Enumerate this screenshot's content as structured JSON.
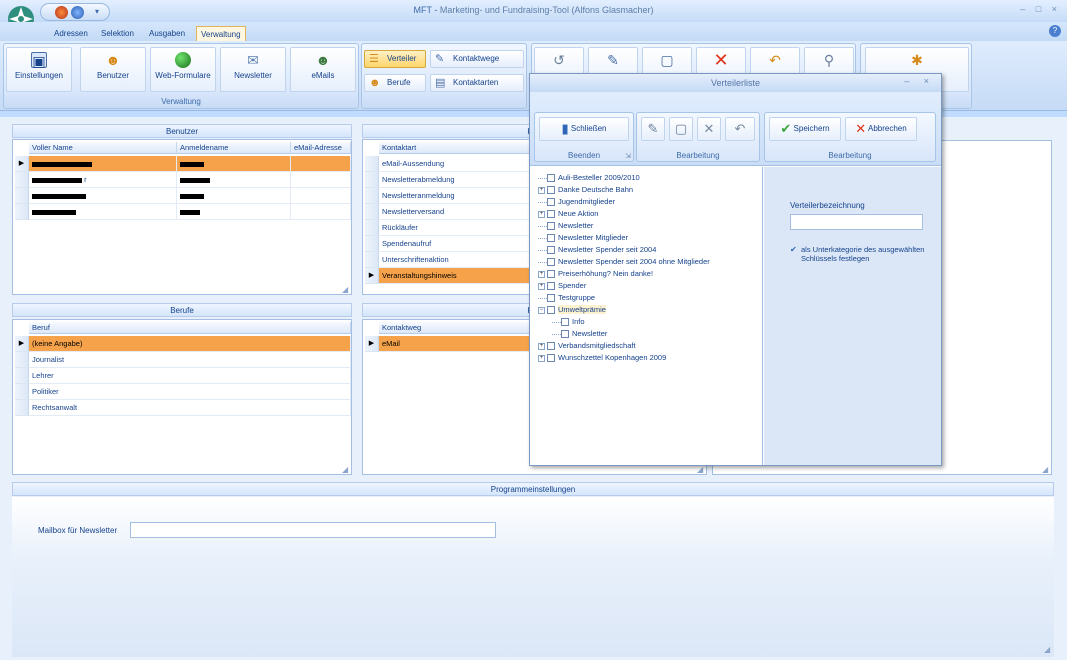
{
  "window": {
    "title_app": "MFT -",
    "title_main": "Marketing- und Fundraising-Tool (Alfons Glasmacher)",
    "controls": "– □ ×"
  },
  "menu": {
    "tabs": [
      "Adressen",
      "Selektion",
      "Ausgaben",
      "Verwaltung"
    ],
    "active": "Verwaltung"
  },
  "ribbon": {
    "verwaltung_group_label": "Verwaltung",
    "buttons_large": [
      "Einstellungen",
      "Benutzer",
      "Web-Formulare",
      "Newsletter",
      "eMails"
    ],
    "buttons_small": [
      "Verteiler",
      "Kontaktwege",
      "Berufe",
      "Kontaktarten"
    ]
  },
  "benutzer": {
    "title": "Benutzer",
    "columns": [
      "Voller Name",
      "Anmeldename",
      "eMail-Adresse"
    ],
    "rows": [
      {
        "name": "[redacted] er",
        "login": "[redacted]",
        "email": ""
      },
      {
        "name": "[redacted] r",
        "login": "[redacted]",
        "email": ""
      },
      {
        "name": "[redacted]",
        "login": "[redacted]",
        "email": ""
      },
      {
        "name": "[redacted]",
        "login": "[redacted]",
        "email": ""
      }
    ]
  },
  "kontaktarten": {
    "title": "Kon",
    "column": "Kontaktart",
    "rows": [
      "eMail-Aussendung",
      "Newsletterabmeldung",
      "Newsletteranmeldung",
      "Newsletterversand",
      "Rückläufer",
      "Spendenaufruf",
      "Unterschriftenaktion",
      "Veranstaltungshinweis"
    ],
    "selected": "Veranstaltungshinweis"
  },
  "berufe": {
    "title": "Berufe",
    "column": "Beruf",
    "rows": [
      "(keine Angabe)",
      "Journalist",
      "Lehrer",
      "Politiker",
      "Rechtsanwalt"
    ],
    "selected": "(keine Angabe)"
  },
  "kontaktwege": {
    "title": "Kon",
    "column": "Kontaktweg",
    "rows": [
      "eMail"
    ],
    "selected": "eMail"
  },
  "programmeinstellungen": {
    "title": "Programmeinstellungen",
    "mailbox_label": "Mailbox für Newsletter",
    "mailbox_value": ""
  },
  "dialog": {
    "title": "Verteilerliste",
    "controls": "– ×",
    "groups": {
      "beenden": "Beenden",
      "bearbeitung1": "Bearbeitung",
      "bearbeitung2": "Bearbeitung"
    },
    "buttons": {
      "schliessen": "Schließen",
      "speichern": "Speichern",
      "abbrechen": "Abbrechen"
    },
    "tree": [
      {
        "label": "Auli-Besteller 2009/2010",
        "expandable": false,
        "level": 0
      },
      {
        "label": "Danke Deutsche Bahn",
        "expandable": true,
        "level": 0
      },
      {
        "label": "Jugendmitglieder",
        "expandable": false,
        "level": 0
      },
      {
        "label": "Neue Aktion",
        "expandable": true,
        "level": 0
      },
      {
        "label": "Newsletter",
        "expandable": false,
        "level": 0
      },
      {
        "label": "Newsletter Mitglieder",
        "expandable": false,
        "level": 0
      },
      {
        "label": "Newsletter Spender seit 2004",
        "expandable": false,
        "level": 0
      },
      {
        "label": "Newsletter Spender seit 2004 ohne Mitglieder",
        "expandable": false,
        "level": 0
      },
      {
        "label": "Preiserhöhung? Nein danke!",
        "expandable": true,
        "level": 0
      },
      {
        "label": "Spender",
        "expandable": true,
        "level": 0
      },
      {
        "label": "Testgruppe",
        "expandable": false,
        "level": 0
      },
      {
        "label": "Umweltprämie",
        "expandable": true,
        "expanded": true,
        "level": 0,
        "highlight": true
      },
      {
        "label": "Info",
        "expandable": false,
        "level": 1
      },
      {
        "label": "Newsletter",
        "expandable": false,
        "level": 1
      },
      {
        "label": "Verbandsmitgliedschaft",
        "expandable": true,
        "level": 0
      },
      {
        "label": "Wunschzettel Kopenhagen 2009",
        "expandable": true,
        "level": 0
      }
    ],
    "verteiler_label": "Verteilerbezeichnung",
    "verteiler_value": "",
    "unterkategorie_checked": true,
    "unterkategorie_label": "als Unterkategorie des ausgewählten Schlüssels festlegen"
  }
}
